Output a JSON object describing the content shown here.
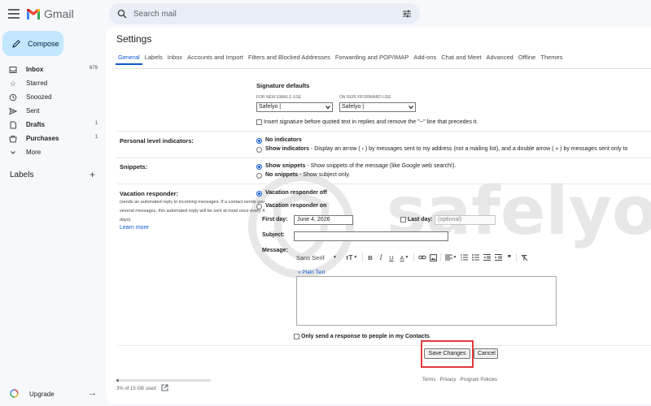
{
  "app": {
    "name": "Gmail"
  },
  "search": {
    "placeholder": "Search mail"
  },
  "compose": {
    "label": "Compose"
  },
  "sidebar": {
    "items": [
      {
        "label": "Inbox",
        "count": "679",
        "icon": "inbox-icon",
        "bold": true
      },
      {
        "label": "Starred",
        "count": "",
        "icon": "star-icon",
        "bold": false
      },
      {
        "label": "Snoozed",
        "count": "",
        "icon": "clock-icon",
        "bold": false
      },
      {
        "label": "Sent",
        "count": "",
        "icon": "send-icon",
        "bold": false
      },
      {
        "label": "Drafts",
        "count": "1",
        "icon": "draft-icon",
        "bold": true
      },
      {
        "label": "Purchases",
        "count": "1",
        "icon": "purchases-icon",
        "bold": true
      },
      {
        "label": "More",
        "count": "",
        "icon": "chevron-down-icon",
        "bold": false
      }
    ],
    "labels_heading": "Labels",
    "upgrade_label": "Upgrade"
  },
  "settings": {
    "title": "Settings",
    "tabs": [
      "General",
      "Labels",
      "Inbox",
      "Accounts and Import",
      "Filters and Blocked Addresses",
      "Forwarding and POP/IMAP",
      "Add-ons",
      "Chat and Meet",
      "Advanced",
      "Offline",
      "Themes"
    ],
    "active_tab": "General",
    "signature": {
      "heading": "Signature defaults",
      "new_label": "FOR NEW EMAILS USE",
      "reply_label": "ON REPLY/FORWARD USE",
      "new_value": "Safelyo |",
      "reply_value": "Safelyo |",
      "insert_text": "Insert signature before quoted text in replies and remove the \"--\" line that precedes it."
    },
    "personal": {
      "label": "Personal level indicators:",
      "opt1": "No indicators",
      "opt2_bold": "Show indicators",
      "opt2_rest": " - Display an arrow ( › ) by messages sent to my address (not a mailing list), and a double arrow ( » ) by messages sent only to"
    },
    "snippets": {
      "label": "Snippets:",
      "opt1_bold": "Show snippets",
      "opt1_rest": " - Show snippets of the message (like Google web search!).",
      "opt2_bold": "No snippets",
      "opt2_rest": " - Show subject only."
    },
    "vacation": {
      "label": "Vacation responder:",
      "desc": "(sends an automated reply to incoming messages. If a contact sends you several messages, this automated reply will be sent at most once every 4 days)",
      "learn_more": "Learn more",
      "off": "Vacation responder off",
      "on": "Vacation responder on",
      "first_day_label": "First day:",
      "first_day_value": "June 4, 2026",
      "last_day_label": "Last day:",
      "last_day_placeholder": "(optional)",
      "subject_label": "Subject:",
      "message_label": "Message:",
      "font_name": "Sans Serif",
      "plain_text_link": "« Plain Text",
      "contacts_only": "Only send a response to people in my Contacts"
    },
    "buttons": {
      "save": "Save Changes",
      "cancel": "Cancel"
    },
    "storage_text": "3% of 15 GB used",
    "storage_fraction": 0.03,
    "footer": "Terms · Privacy · Program Policies"
  },
  "watermark": "safelyo",
  "colors": {
    "accent": "#0b57d0",
    "compose_bg": "#c2e7ff",
    "highlight": "#e23a3a"
  }
}
